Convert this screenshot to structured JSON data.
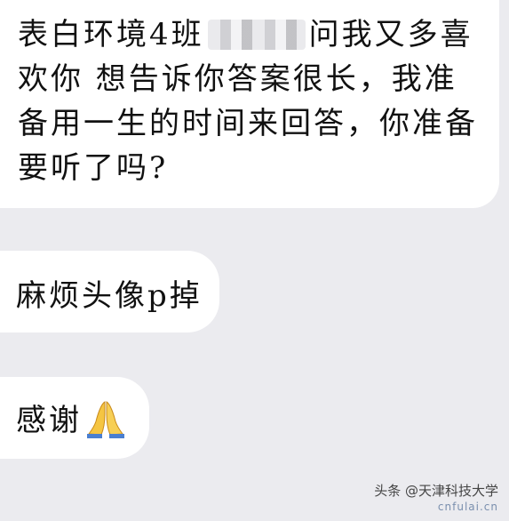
{
  "messages": [
    {
      "lines": [
        {
          "before": "表白环境4班",
          "after": "问我又多喜"
        },
        {
          "text": "欢你 想告诉你答案很长，我准"
        },
        {
          "text": "备用一生的时间来回答，你准备"
        },
        {
          "text": "要听了吗?"
        }
      ]
    },
    {
      "text": "麻烦头像p掉"
    },
    {
      "text": "感谢",
      "emoji": "folded-hands-icon"
    }
  ],
  "watermark": {
    "label": "头条 @天津科技大学",
    "site": "cnfulai.cn"
  },
  "colors": {
    "background": "#ebebef",
    "bubble": "#ffffff",
    "text": "#111111"
  }
}
